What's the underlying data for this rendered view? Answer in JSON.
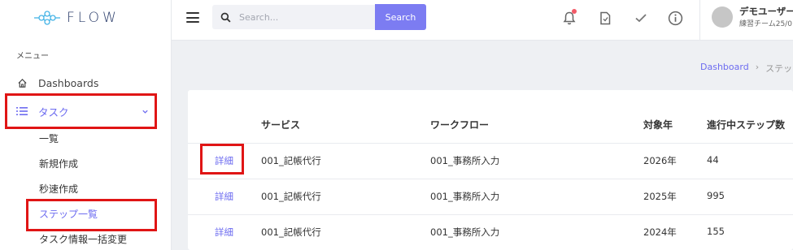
{
  "brand": {
    "logo_text": "FLOW"
  },
  "sidebar": {
    "caption": "メニュー",
    "items": [
      {
        "label": "Dashboards",
        "icon": "home-icon"
      },
      {
        "label": "タスク",
        "icon": "list-icon"
      }
    ],
    "sub_items": [
      "一覧",
      "新規作成",
      "秒速作成",
      "ステップ一覧",
      "タスク情報一括変更"
    ]
  },
  "header": {
    "search_placeholder": "Search...",
    "search_button": "Search",
    "user_name": "デモユーザー",
    "user_sub": "練習チーム25/0"
  },
  "breadcrumb": {
    "home": "Dashboard",
    "sep": "›",
    "current": "ステッ"
  },
  "table": {
    "columns": [
      "",
      "サービス",
      "ワークフロー",
      "対象年",
      "進行中ステップ数"
    ],
    "rows": [
      {
        "action": "詳細",
        "service": "001_記帳代行",
        "workflow": "001_事務所入力",
        "year": "2026年",
        "steps": "44"
      },
      {
        "action": "詳細",
        "service": "001_記帳代行",
        "workflow": "001_事務所入力",
        "year": "2025年",
        "steps": "995"
      },
      {
        "action": "詳細",
        "service": "001_記帳代行",
        "workflow": "001_事務所入力",
        "year": "2024年",
        "steps": "155"
      }
    ]
  },
  "colors": {
    "accent": "#7c7cf2",
    "highlight": "#e01515"
  }
}
